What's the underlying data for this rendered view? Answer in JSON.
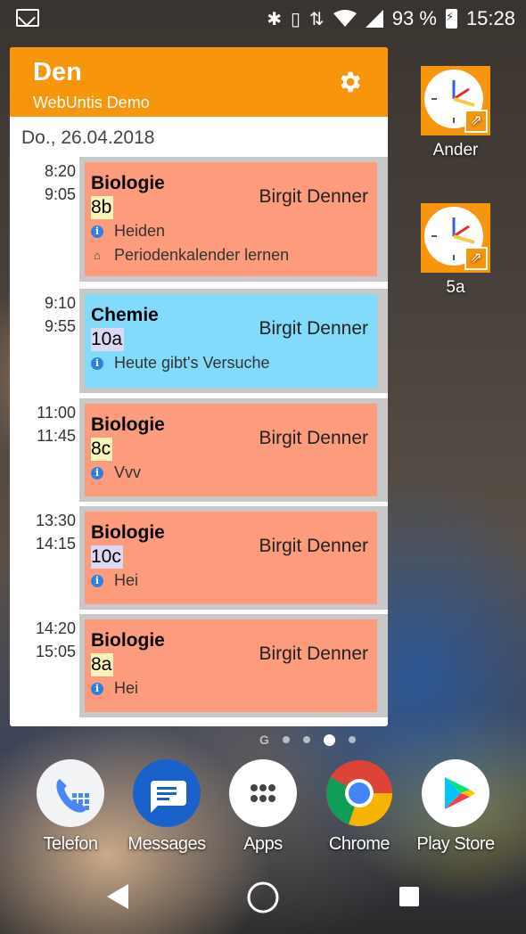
{
  "status_bar": {
    "battery": "93 %",
    "time": "15:28",
    "icons": [
      "gmail-icon",
      "bluetooth-icon",
      "vibrate-icon",
      "data-icon",
      "wifi-icon",
      "signal-icon",
      "battery-charging-icon"
    ]
  },
  "widget": {
    "title": "Den",
    "subtitle": "WebUntis Demo",
    "header_color": "#f7960d",
    "date": "Do., 26.04.2018",
    "lessons": [
      {
        "start": "8:20",
        "end": "9:05",
        "subject": "Biologie",
        "class": "8b",
        "teacher": "Birgit Denner",
        "color": "#fd9c7c",
        "class_bg": "#fbf3b8",
        "notes": [
          {
            "icon": "info-icon",
            "text": "Heiden"
          },
          {
            "icon": "home-icon",
            "text": "Periodenkalender lernen"
          }
        ]
      },
      {
        "start": "9:10",
        "end": "9:55",
        "subject": "Chemie",
        "class": "10a",
        "teacher": "Birgit Denner",
        "color": "#82dbfb",
        "class_bg": "#dcd7f3",
        "notes": [
          {
            "icon": "info-icon",
            "text": "Heute gibt's Versuche"
          }
        ]
      },
      {
        "start": "11:00",
        "end": "11:45",
        "subject": "Biologie",
        "class": "8c",
        "teacher": "Birgit Denner",
        "color": "#fd9c7c",
        "class_bg": "#fbf3b8",
        "notes": [
          {
            "icon": "info-icon",
            "text": "Vvv"
          }
        ]
      },
      {
        "start": "13:30",
        "end": "14:15",
        "subject": "Biologie",
        "class": "10c",
        "teacher": "Birgit Denner",
        "color": "#fd9c7c",
        "class_bg": "#dcd7f3",
        "notes": [
          {
            "icon": "info-icon",
            "text": "Hei"
          }
        ]
      },
      {
        "start": "14:20",
        "end": "15:05",
        "subject": "Biologie",
        "class": "8a",
        "teacher": "Birgit Denner",
        "color": "#fd9c7c",
        "class_bg": "#fbf3b8",
        "notes": [
          {
            "icon": "info-icon",
            "text": "Hei"
          }
        ]
      }
    ]
  },
  "shortcuts": [
    {
      "label": "Ander"
    },
    {
      "label": "5a"
    }
  ],
  "dock": [
    {
      "label": "Telefon",
      "icon": "phone-icon"
    },
    {
      "label": "Messages",
      "icon": "messages-icon"
    },
    {
      "label": "Apps",
      "icon": "apps-icon"
    },
    {
      "label": "Chrome",
      "icon": "chrome-icon"
    },
    {
      "label": "Play Store",
      "icon": "play-store-icon"
    }
  ]
}
